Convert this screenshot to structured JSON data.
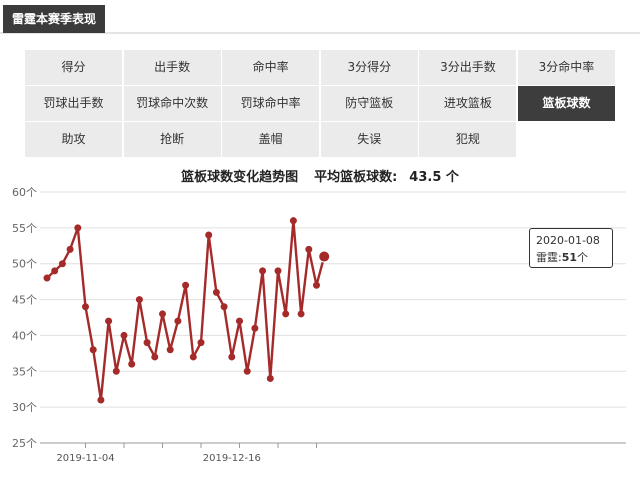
{
  "header": {
    "title": "雷霆本赛季表现"
  },
  "stats": {
    "rows": [
      [
        "得分",
        "出手数",
        "命中率",
        "3分得分",
        "3分出手数",
        "3分命中率"
      ],
      [
        "罚球出手数",
        "罚球命中次数",
        "罚球命中率",
        "防守篮板",
        "进攻篮板",
        "篮板球数"
      ],
      [
        "助攻",
        "抢断",
        "盖帽",
        "失误",
        "犯规"
      ]
    ],
    "active": "篮板球数"
  },
  "chart_title": {
    "title": "篮板球数变化趋势图",
    "avg_label": "平均篮板球数:",
    "avg_value": "43.5 个"
  },
  "tooltip": {
    "date": "2020-01-08",
    "team": "雷霆",
    "separator": ":",
    "value": "51",
    "unit": "个"
  },
  "colors": {
    "line": "#a52a2a",
    "active_bg": "#3d3d3d",
    "cell_bg": "#ebebeb"
  },
  "chart_data": {
    "type": "line",
    "title": "篮板球数变化趋势图",
    "xlabel": "",
    "ylabel": "",
    "ylim": [
      25,
      60
    ],
    "yticks": [
      "25个",
      "30个",
      "35个",
      "40个",
      "45个",
      "50个",
      "55个",
      "60个"
    ],
    "yticks_values": [
      25,
      30,
      35,
      40,
      45,
      50,
      55,
      60
    ],
    "xtick_labels": [
      {
        "label": "2019-11-04",
        "index": 5
      },
      {
        "label": "2019-12-16",
        "index": 24
      }
    ],
    "grid": true,
    "series": [
      {
        "values": [
          48,
          49,
          50,
          52,
          55,
          44,
          38,
          31,
          42,
          35,
          40,
          36,
          45,
          39,
          37,
          43,
          38,
          42,
          47,
          37,
          39,
          54,
          46,
          44,
          37,
          42,
          35,
          41,
          49,
          34,
          49,
          43,
          56,
          43,
          52,
          47,
          51
        ]
      }
    ],
    "highlight_index": 36
  }
}
